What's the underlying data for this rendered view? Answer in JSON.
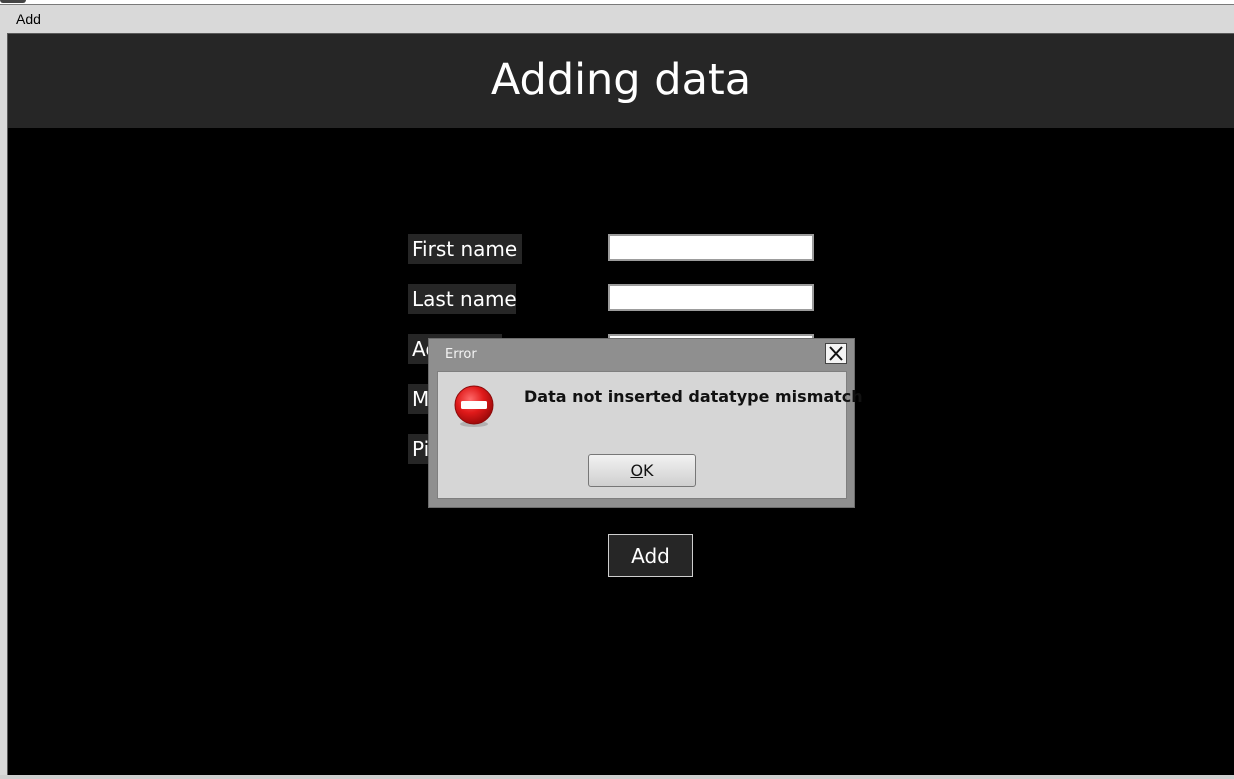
{
  "menubar": {
    "items": [
      {
        "label": "Add"
      }
    ]
  },
  "header": {
    "title": "Adding data"
  },
  "form": {
    "fields": [
      {
        "label": "First name",
        "value": ""
      },
      {
        "label": "Last name",
        "value": ""
      },
      {
        "label": "Ac",
        "value": ""
      },
      {
        "label": "M",
        "value": ""
      },
      {
        "label": "Pi",
        "value": ""
      }
    ],
    "submit_label": "Add"
  },
  "dialog": {
    "title": "Error",
    "icon": "error-stop-icon",
    "message": "Data not inserted datatype mismatch",
    "ok_mnemonic": "O",
    "ok_rest": "K"
  },
  "colors": {
    "background": "#000000",
    "header": "#262626",
    "label_bg": "#262626",
    "error_red": "#d41414"
  }
}
